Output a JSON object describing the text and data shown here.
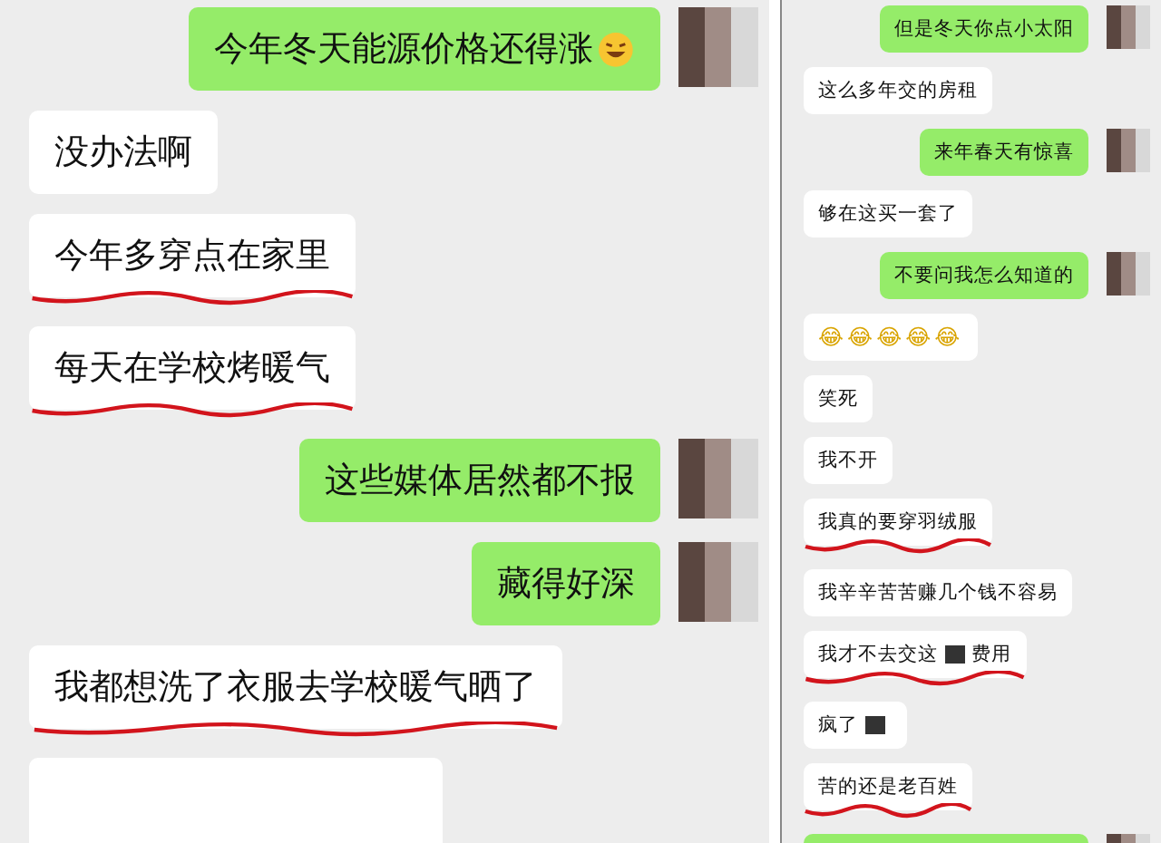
{
  "left_chat": {
    "messages": [
      {
        "outgoing": true,
        "kind": "text_emoji",
        "text": "今年冬天能源价格还得涨",
        "underlined": false
      },
      {
        "outgoing": false,
        "kind": "text",
        "text": "没办法啊",
        "underlined": false
      },
      {
        "outgoing": false,
        "kind": "text",
        "text": "今年多穿点在家里",
        "underlined": true
      },
      {
        "outgoing": false,
        "kind": "text",
        "text": "每天在学校烤暖气",
        "underlined": true
      },
      {
        "outgoing": true,
        "kind": "text",
        "text": "这些媒体居然都不报",
        "underlined": false
      },
      {
        "outgoing": true,
        "kind": "text",
        "text": "藏得好深",
        "underlined": false
      },
      {
        "outgoing": false,
        "kind": "text",
        "text": "我都想洗了衣服去学校暖气晒了",
        "underlined": true
      },
      {
        "outgoing": false,
        "kind": "cut_off",
        "underlined": false
      }
    ]
  },
  "right_chat": {
    "messages": [
      {
        "outgoing": true,
        "kind": "text",
        "text": "但是冬天你点小太阳",
        "underlined": false
      },
      {
        "outgoing": false,
        "kind": "text",
        "text": "这么多年交的房租",
        "underlined": false
      },
      {
        "outgoing": true,
        "kind": "text",
        "text": "来年春天有惊喜",
        "underlined": false
      },
      {
        "outgoing": false,
        "kind": "text",
        "text": "够在这买一套了",
        "underlined": false
      },
      {
        "outgoing": true,
        "kind": "text",
        "text": "不要问我怎么知道的",
        "underlined": false
      },
      {
        "outgoing": false,
        "kind": "emoji_row",
        "emojis": [
          "😂",
          "😂",
          "😂",
          "😂",
          "😂"
        ],
        "underlined": false
      },
      {
        "outgoing": false,
        "kind": "text",
        "text": "笑死",
        "underlined": false
      },
      {
        "outgoing": false,
        "kind": "text",
        "text": "我不开",
        "underlined": false
      },
      {
        "outgoing": false,
        "kind": "text",
        "text": "我真的要穿羽绒服",
        "underlined": true
      },
      {
        "outgoing": false,
        "kind": "text",
        "text": "我辛辛苦苦赚几个钱不容易",
        "underlined": false
      },
      {
        "outgoing": false,
        "kind": "text",
        "text": "我才不去交这",
        "redacted": true,
        "after": "费用",
        "underlined": true
      },
      {
        "outgoing": false,
        "kind": "text",
        "text": "疯了",
        "redacted": true,
        "underlined": false
      },
      {
        "outgoing": false,
        "kind": "text",
        "text": "苦的还是老百姓",
        "underlined": true
      },
      {
        "outgoing": true,
        "kind": "cut_off",
        "underlined": false
      }
    ]
  }
}
